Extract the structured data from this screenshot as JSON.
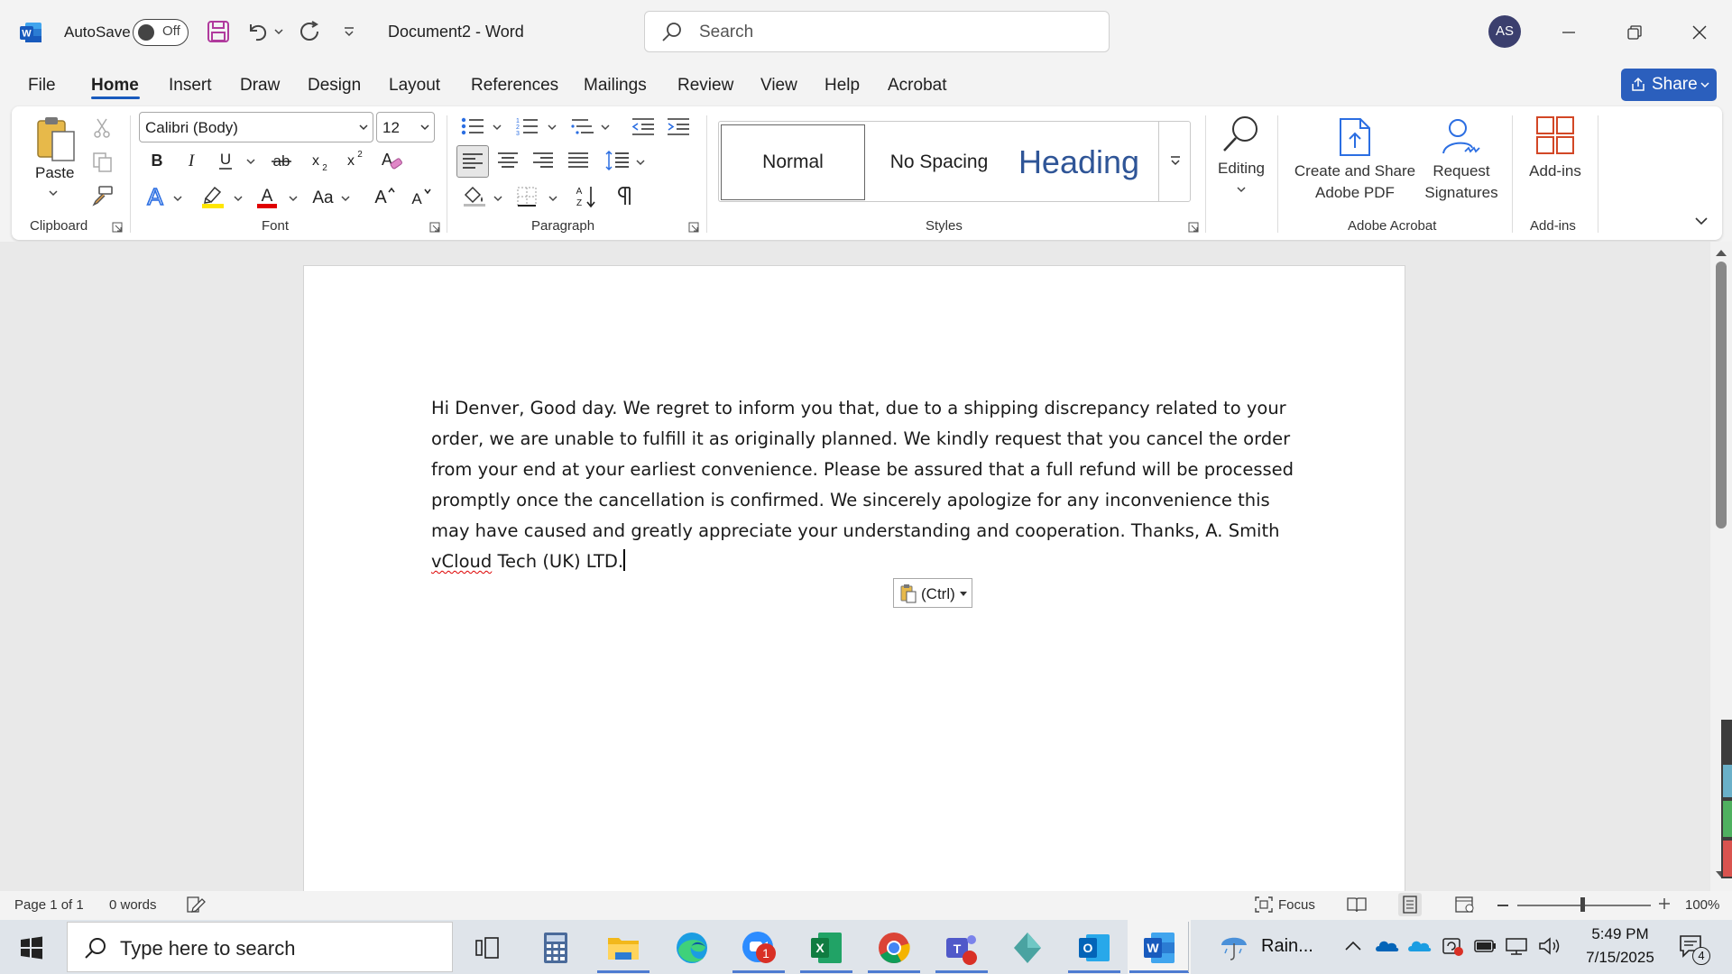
{
  "titlebar": {
    "autosave_label": "AutoSave",
    "autosave_state": "Off",
    "document_title": "Document2  -  Word",
    "search_placeholder": "Search",
    "user_initials": "AS"
  },
  "tabs": [
    "File",
    "Home",
    "Insert",
    "Draw",
    "Design",
    "Layout",
    "References",
    "Mailings",
    "Review",
    "View",
    "Help",
    "Acrobat"
  ],
  "share_label": "Share",
  "ribbon": {
    "clipboard": {
      "paste_label": "Paste",
      "group_label": "Clipboard"
    },
    "font": {
      "font_name": "Calibri (Body)",
      "font_size": "12",
      "group_label": "Font"
    },
    "paragraph": {
      "group_label": "Paragraph"
    },
    "styles": {
      "normal": "Normal",
      "no_spacing": "No Spacing",
      "heading": "Heading",
      "group_label": "Styles"
    },
    "editing": {
      "label": "Editing"
    },
    "acrobat": {
      "create_share_line1": "Create and Share",
      "create_share_line2": "Adobe PDF",
      "request_line1": "Request",
      "request_line2": "Signatures",
      "group_label": "Adobe Acrobat"
    },
    "addins": {
      "label": "Add-ins",
      "group_label": "Add-ins"
    }
  },
  "document": {
    "text_before": "Hi Denver, Good day. We regret to inform you that, due to a shipping discrepancy related to your order, we are unable to fulfill it as originally planned. We kindly request that you cancel the order from your end at your earliest convenience. Please be assured that a full refund will be processed promptly once the cancellation is confirmed. We sincerely apologize for any inconvenience this may have caused and greatly appreciate your understanding and cooperation. Thanks, A. Smith ",
    "misspelled_word": "vCloud",
    "text_after": " Tech (UK) LTD.",
    "paste_options_label": "(Ctrl)"
  },
  "statusbar": {
    "page": "Page 1 of 1",
    "words": "0 words",
    "focus": "Focus",
    "zoom": "100%"
  },
  "taskbar": {
    "search_placeholder": "Type here to search",
    "zoom_badge": "1",
    "weather": "Rain...",
    "time": "5:49 PM",
    "date": "7/15/2025",
    "notification_count": "4"
  },
  "colors": {
    "accent": "#185abd",
    "share": "#2b5fbd",
    "word_blue": "#185abd",
    "highlight_yellow": "#ffe600",
    "font_red": "#e00000"
  }
}
